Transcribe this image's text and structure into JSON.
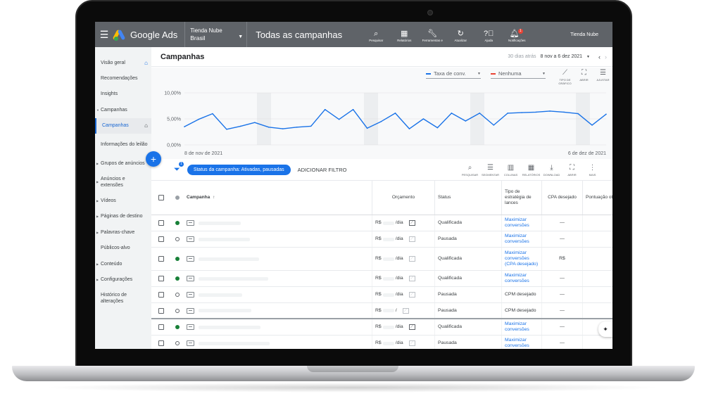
{
  "topbar": {
    "brand": "Google Ads",
    "account_name": "Tienda Nube",
    "account_region": "Brasil",
    "page_title": "Todas as campanhas",
    "tools": [
      {
        "label": "Pesquisar",
        "icon": "search-icon"
      },
      {
        "label": "Relatórios",
        "icon": "reports-icon"
      },
      {
        "label": "Ferramentas e configurações",
        "icon": "wrench-icon"
      },
      {
        "label": "Atualizar",
        "icon": "refresh-icon"
      },
      {
        "label": "Ajuda",
        "icon": "help-icon"
      },
      {
        "label": "Notificações",
        "icon": "bell-icon",
        "badge": "1"
      }
    ],
    "user": "Tienda Nube"
  },
  "sidebar": {
    "items": [
      {
        "label": "Visão geral"
      },
      {
        "label": "Recomendações"
      },
      {
        "label": "Insights"
      },
      {
        "label": "Campanhas"
      },
      {
        "label": "Campanhas"
      },
      {
        "label": "Informações do leilão"
      },
      {
        "label": "Grupos de anúncios"
      },
      {
        "label": "Anúncios e extensões"
      },
      {
        "label": "Vídeos"
      },
      {
        "label": "Páginas de destino"
      },
      {
        "label": "Palavras-chave"
      },
      {
        "label": "Públicos-alvo"
      },
      {
        "label": "Conteúdo"
      },
      {
        "label": "Configurações"
      },
      {
        "label": "Histórico de alterações"
      }
    ]
  },
  "main": {
    "title": "Campanhas",
    "range_label": "30 dias atrás",
    "range_dates": "8 nov a 6 dez 2021"
  },
  "chart_controls": {
    "metric1": "Taxa de conv.",
    "metric1_color": "#1a73e8",
    "metric2": "Nenhuma",
    "metric2_color": "#ea4335",
    "icons": [
      {
        "label": "TIPO DE GRÁFICO"
      },
      {
        "label": "ABRIR"
      },
      {
        "label": "AJUSTAR"
      }
    ]
  },
  "chart_data": {
    "type": "line",
    "series": [
      {
        "values": [
          3.5,
          4.9,
          6.0,
          3.0,
          3.6,
          4.3,
          3.4,
          3.1,
          3.4,
          3.6,
          6.8,
          4.9,
          6.8,
          3.2,
          4.5,
          6.1,
          3.1,
          5.0,
          3.3,
          6.1,
          4.6,
          6.1,
          3.8,
          6.1,
          6.2,
          6.3,
          6.5,
          6.3,
          6.0,
          3.8,
          5.9
        ]
      }
    ],
    "x_start_label": "8 de nov de 2021",
    "x_end_label": "6 de dez de 2021",
    "y_ticks": [
      "10,00%",
      "5,00%",
      "0,00%"
    ],
    "ylim": [
      0,
      10
    ],
    "line_color": "#1a73e8",
    "grid": true
  },
  "filterbar": {
    "filter_count": "1",
    "chip": "Status da campanha: Ativadas, pausadas",
    "add_filter": "ADICIONAR FILTRO",
    "tools": [
      {
        "label": "PESQUISAR"
      },
      {
        "label": "SEGMENTAR"
      },
      {
        "label": "COLUNAS"
      },
      {
        "label": "RELATÓRIOS"
      },
      {
        "label": "DOWNLOAD"
      },
      {
        "label": "ABRIR"
      },
      {
        "label": "MAIS"
      }
    ]
  },
  "table": {
    "headers": {
      "campaign": "Campanha",
      "budget": "Orçamento",
      "status": "Status",
      "bid_type": "Tipo de estratégia de lances",
      "cpa": "CPA desejado",
      "score": "Pontuação otimização"
    },
    "rows": [
      {
        "state": "on",
        "budget": "R$",
        "per": "/dia",
        "chart": true,
        "status": "Qualificada",
        "bid": "Maximizar conversões",
        "bid_link": true,
        "cpa": "—"
      },
      {
        "state": "off",
        "budget": "R$",
        "per": "/dia",
        "chart": false,
        "status": "Pausada",
        "bid": "Maximizar conversões",
        "bid_link": true,
        "cpa": "—"
      },
      {
        "state": "on",
        "budget": "R$",
        "per": "/dia",
        "chart": false,
        "status": "Qualificada",
        "bid": "Maximizar conversões (CPA desejado)",
        "bid_link": true,
        "cpa": "R$"
      },
      {
        "state": "on",
        "budget": "R$",
        "per": "/dia",
        "chart": false,
        "status": "Qualificada",
        "bid": "Maximizar conversões",
        "bid_link": true,
        "cpa": "—"
      },
      {
        "state": "off",
        "budget": "R$",
        "per": "/dia",
        "chart": false,
        "status": "Pausada",
        "bid": "CPM desejado",
        "bid_link": false,
        "cpa": "—"
      },
      {
        "state": "off",
        "budget": "R$",
        "per": "/",
        "chart": false,
        "status": "Pausada",
        "bid": "CPM desejado",
        "bid_link": false,
        "cpa": "—"
      },
      {
        "state": "on",
        "budget": "R$",
        "per": "/dia",
        "chart": true,
        "status": "Qualificada",
        "bid": "Maximizar conversões",
        "bid_link": true,
        "cpa": "—"
      },
      {
        "state": "off",
        "budget": "R$",
        "per": "/dia",
        "chart": false,
        "status": "Pausada",
        "bid": "Maximizar conversões",
        "bid_link": true,
        "cpa": "—"
      }
    ]
  }
}
